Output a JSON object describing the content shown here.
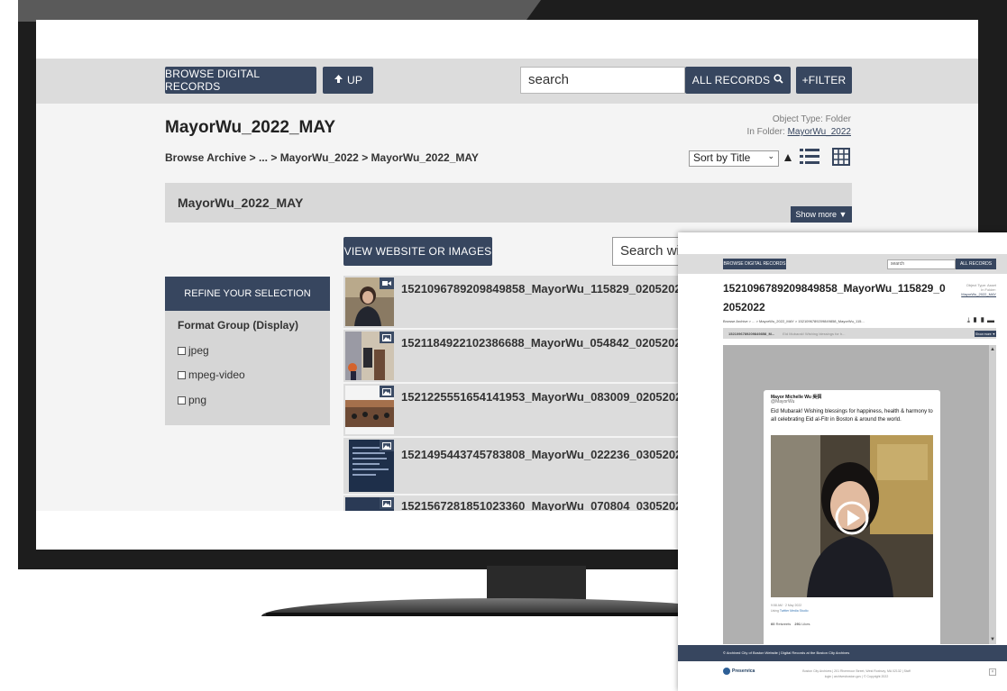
{
  "main": {
    "header": {
      "browse_button": "BROWSE DIGITAL RECORDS",
      "up_button": "UP",
      "search_placeholder": "search",
      "scope_button": "ALL RECORDS",
      "filter_button": "+FILTER"
    },
    "folder": {
      "title": "MayorWu_2022_MAY",
      "object_type": "Object Type: Folder",
      "in_folder_label": "In Folder:",
      "in_folder_link": "MayorWu_2022"
    },
    "breadcrumb": [
      "Browse Archive",
      "...",
      "MayorWu_2022",
      "MayorWu_2022_MAY"
    ],
    "breadcrumb_sep": ">",
    "sort": {
      "selected": "Sort by Title",
      "direction_icon": "triangle-up-icon",
      "icons": [
        "list-view-icon",
        "grid-view-icon"
      ]
    },
    "summary": {
      "title": "MayorWu_2022_MAY",
      "show_more": "Show more ▼"
    },
    "view_button": "VIEW WEBSITE OR IMAGES",
    "search_within": "Search wi",
    "refine": {
      "header": "REFINE YOUR SELECTION",
      "group": "Format Group (Display)",
      "facets": [
        "jpeg",
        "mpeg-video",
        "png"
      ]
    },
    "results": [
      {
        "title": "1521096789209849858_MayorWu_115829_02052022",
        "badge": "video-icon"
      },
      {
        "title": "1521184922102386688_MayorWu_054842_02052022",
        "badge": "image-icon"
      },
      {
        "title": "1521225551654141953_MayorWu_083009_02052022",
        "badge": "image-icon"
      },
      {
        "title": "1521495443745783808_MayorWu_022236_03052022",
        "badge": "image-icon"
      },
      {
        "title": "1521567281851023360_MayorWu_070804_03052022",
        "badge": "image-icon"
      }
    ]
  },
  "overlay": {
    "browse_button": "BROWSE DIGITAL RECORDS",
    "search_placeholder": "search",
    "scope_button": "ALL RECORDS",
    "title": "1521096789209849858_MayorWu_115829_02052022",
    "meta_lines": [
      "Object Type: Asset",
      "In Folder:",
      "MayorWu_2022_MAY"
    ],
    "breadcrumb": "Browse Archive > ... > MayorWu_2022_MAY > 1521096789209849858_MayorWu_115...",
    "summary": "1521096789209849858_M...",
    "summary_sub": "Eid Mubarak! Wishing blessings for h...",
    "show_more": "Show more ▼",
    "tweet": {
      "name": "Mayor Michelle Wu 吳弭",
      "handle": "@MayorWu",
      "text": "Eid Mubarak! Wishing blessings for happiness, health & harmony to all celebrating Eid al-Fitr in Boston & around the world.",
      "date": "9:58 AM · 2 May 2022",
      "via_label": "Using",
      "via": "Twitter Media Studio",
      "retweets": "60",
      "retweets_label": "Retweets",
      "likes": "291",
      "likes_label": "Likes"
    },
    "footer": "© Archived City of Boston Website  |  Digital Records at the Boston City Archives",
    "logo": "Preservica",
    "credit": "Boston City Archives | 201 Rivermoor Street, West Roxbury, MA 02132 | Staff login | archivesboston.gov | © Copyright 2022"
  },
  "colors": {
    "accent": "#37465f",
    "panel": "#dcdcdc",
    "bezel": "#1d1d1d"
  }
}
